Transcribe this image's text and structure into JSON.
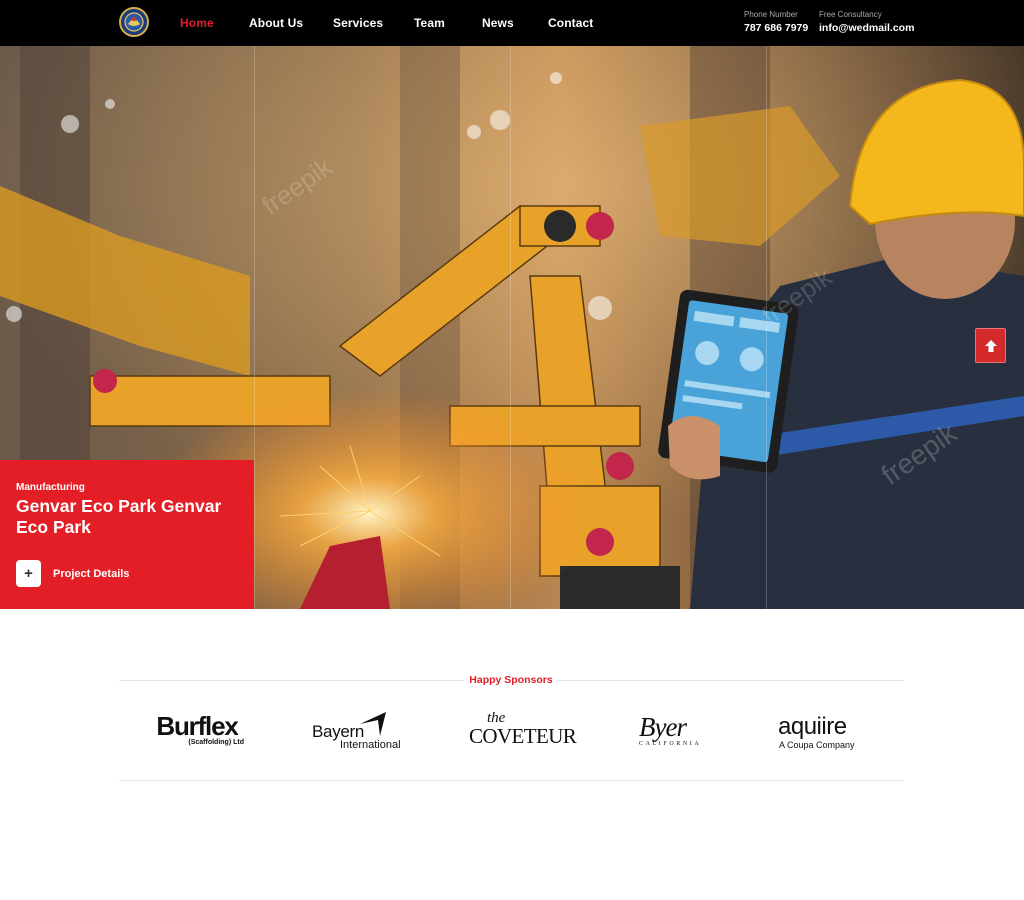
{
  "header": {
    "nav": [
      {
        "label": "Home",
        "active": true
      },
      {
        "label": "About Us",
        "active": false
      },
      {
        "label": "Services",
        "active": false
      },
      {
        "label": "Team",
        "active": false
      },
      {
        "label": "News",
        "active": false
      },
      {
        "label": "Contact",
        "active": false
      }
    ],
    "phone": {
      "label": "Phone Number",
      "value": "787 686 7979"
    },
    "consult": {
      "label": "Free Consultancy",
      "value": "info@wedmail.com"
    }
  },
  "hero": {
    "category": "Manufacturing",
    "title": "Genvar Eco Park Genvar Eco Park",
    "button_label": "Project Details",
    "button_icon": "plus-icon",
    "watermark": "freepik"
  },
  "sponsors": {
    "title": "Happy Sponsors",
    "logos": [
      {
        "name": "Burflex",
        "sub": "(Scaffolding) Ltd"
      },
      {
        "name": "Bayern",
        "sub": "International"
      },
      {
        "name": "COVETEUR",
        "sub": "the"
      },
      {
        "name": "Byer",
        "sub": "CALIFORNIA"
      },
      {
        "name": "aquiire",
        "sub": "A Coupa Company"
      }
    ]
  },
  "colors": {
    "accent": "#e41e26",
    "header_bg": "#000000",
    "scroll_button": "#d42a2c"
  },
  "icons": [
    "emblem-logo-icon",
    "arrow-up-icon",
    "plus-icon"
  ]
}
